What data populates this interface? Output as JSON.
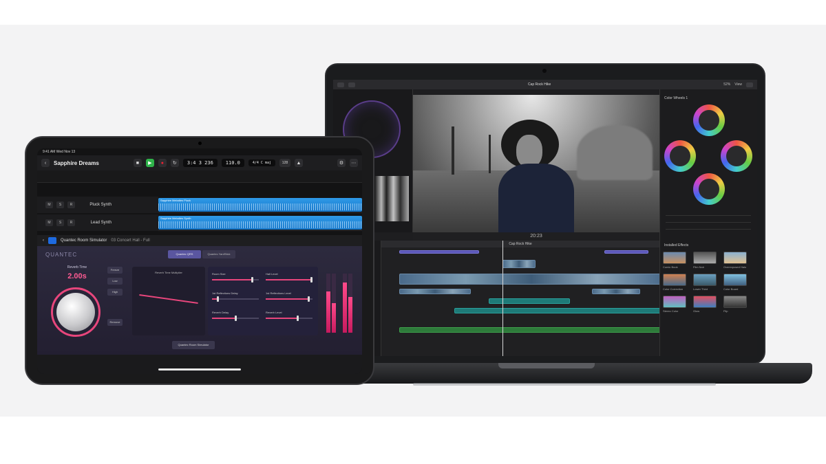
{
  "fcp": {
    "toolbar_title": "Cap Rock Hike",
    "zoom": "52%",
    "view_menu": "View",
    "timecode": "20:23",
    "inspector_title": "Color Wheels 1",
    "timeline_title": "Cap Rock Hike",
    "effects_title": "Installed Effects",
    "effects": [
      "Comic Book",
      "Film Noir",
      "Overexposed Halo",
      "Color Correction",
      "Lower Third",
      "Color Board",
      "Stereo Color",
      "Glow",
      "Flip"
    ]
  },
  "logic": {
    "status_time": "9:41 AM",
    "status_date": "Wed Nov 13",
    "project_title": "Sapphire Dreams",
    "lcd_position": "3:4 3  236",
    "lcd_tempo": "110.0",
    "lcd_signature": "4/4 C maj",
    "key": "128",
    "tracks": [
      {
        "name": "Pluck Synth",
        "region": "Sapphire Melodies Pluck"
      },
      {
        "name": "Lead Synth",
        "region": "Sapphire Melodies Synth"
      }
    ],
    "plugin_name": "Quantec Room Simulator",
    "plugin_preset": "03 Concert Hall - Full",
    "plugin_logo": "QUANTEC",
    "tab_a": "Quantec QRS",
    "tab_b": "Quantec YardStick",
    "reverb_label": "Reverb Time",
    "reverb_value": "2.00s",
    "room_button": "Quantec Room Simulator",
    "graph_title": "Reverb Time Multiplier",
    "sliders": [
      "Room Size",
      "1st Reflections Delay",
      "Reverb Delay",
      "Hall Level",
      "1st Reflections Level",
      "Reverb Level"
    ],
    "side_buttons": [
      "Freeze",
      "Low",
      "High",
      "Remove"
    ],
    "meters": [
      0.7,
      0.5,
      0.85,
      0.6
    ]
  }
}
